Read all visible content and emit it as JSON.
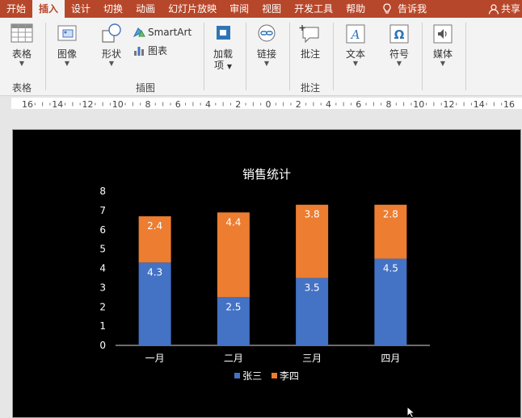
{
  "tabs": [
    {
      "id": "home",
      "label": "开始"
    },
    {
      "id": "insert",
      "label": "插入",
      "active": true
    },
    {
      "id": "design",
      "label": "设计"
    },
    {
      "id": "transitions",
      "label": "切换"
    },
    {
      "id": "animations",
      "label": "动画"
    },
    {
      "id": "slideshow",
      "label": "幻灯片放映"
    },
    {
      "id": "review",
      "label": "审阅"
    },
    {
      "id": "view",
      "label": "视图"
    },
    {
      "id": "developer",
      "label": "开发工具"
    },
    {
      "id": "help",
      "label": "帮助"
    }
  ],
  "tell_me": "告诉我",
  "share": "共享",
  "ribbon": {
    "table": "表格",
    "image": "图像",
    "shapes": "形状",
    "smartart": "SmartArt",
    "chart": "图表",
    "addins_line1": "加载",
    "addins_line2": "项",
    "link": "链接",
    "comment": "批注",
    "text": "文本",
    "symbol": "符号",
    "media": "媒体",
    "groups": {
      "tables": "表格",
      "illustrations": "插图",
      "comments": "批注"
    }
  },
  "ruler_labels": [
    "16",
    "14",
    "12",
    "10",
    "8",
    "6",
    "4",
    "2",
    "0",
    "2",
    "4",
    "6",
    "8",
    "10",
    "12",
    "14",
    "16"
  ],
  "colors": {
    "accent": "#b7472a",
    "series1": "#4472c4",
    "series2": "#ed7d31"
  },
  "chart_data": {
    "type": "bar",
    "stacked": true,
    "title": "销售统计",
    "categories": [
      "一月",
      "二月",
      "三月",
      "四月"
    ],
    "series": [
      {
        "name": "张三",
        "values": [
          4.3,
          2.5,
          3.5,
          4.5
        ]
      },
      {
        "name": "李四",
        "values": [
          2.4,
          4.4,
          3.8,
          2.8
        ]
      }
    ],
    "ylim": [
      0,
      8
    ],
    "yticks": [
      0,
      1,
      2,
      3,
      4,
      5,
      6,
      7,
      8
    ],
    "grid": false,
    "legend": "bottom"
  }
}
